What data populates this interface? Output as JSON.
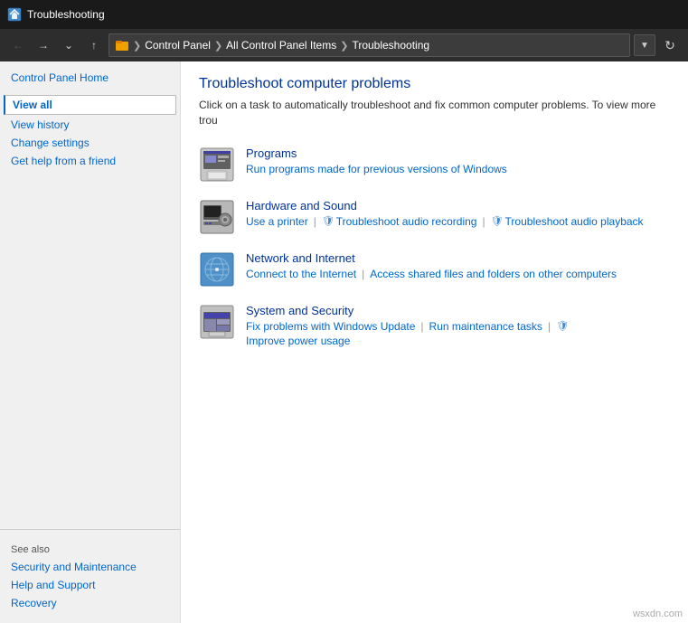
{
  "titlebar": {
    "icon": "troubleshoot",
    "title": "Troubleshooting"
  },
  "addressbar": {
    "path": [
      {
        "label": "Control Panel"
      },
      {
        "label": "All Control Panel Items"
      },
      {
        "label": "Troubleshooting"
      }
    ],
    "folder_icon": "📁"
  },
  "sidebar": {
    "home_link": "Control Panel Home",
    "nav_links": [
      {
        "label": "View all",
        "active": true
      },
      {
        "label": "View history"
      },
      {
        "label": "Change settings"
      },
      {
        "label": "Get help from a friend"
      }
    ],
    "see_also_title": "See also",
    "see_also_links": [
      {
        "label": "Security and Maintenance"
      },
      {
        "label": "Help and Support"
      },
      {
        "label": "Recovery"
      }
    ]
  },
  "content": {
    "title": "Troubleshoot computer problems",
    "description": "Click on a task to automatically troubleshoot and fix common computer problems. To view more trou",
    "categories": [
      {
        "name": "Programs",
        "icon_type": "programs",
        "links": [
          {
            "label": "Run programs made for previous versions of Windows",
            "has_shield": false
          }
        ]
      },
      {
        "name": "Hardware and Sound",
        "icon_type": "hardware",
        "links": [
          {
            "label": "Use a printer",
            "has_shield": false
          },
          {
            "label": "Troubleshoot audio recording",
            "has_shield": true
          },
          {
            "label": "Troubleshoot audio playback",
            "has_shield": true
          }
        ]
      },
      {
        "name": "Network and Internet",
        "icon_type": "network",
        "links": [
          {
            "label": "Connect to the Internet",
            "has_shield": false
          },
          {
            "label": "Access shared files and folders on other computers",
            "has_shield": false
          }
        ]
      },
      {
        "name": "System and Security",
        "icon_type": "security",
        "links": [
          {
            "label": "Fix problems with Windows Update",
            "has_shield": false
          },
          {
            "label": "Run maintenance tasks",
            "has_shield": false
          },
          {
            "label": "Improve power usage",
            "has_shield": true
          }
        ]
      }
    ]
  },
  "watermark": "wsxdn.com"
}
